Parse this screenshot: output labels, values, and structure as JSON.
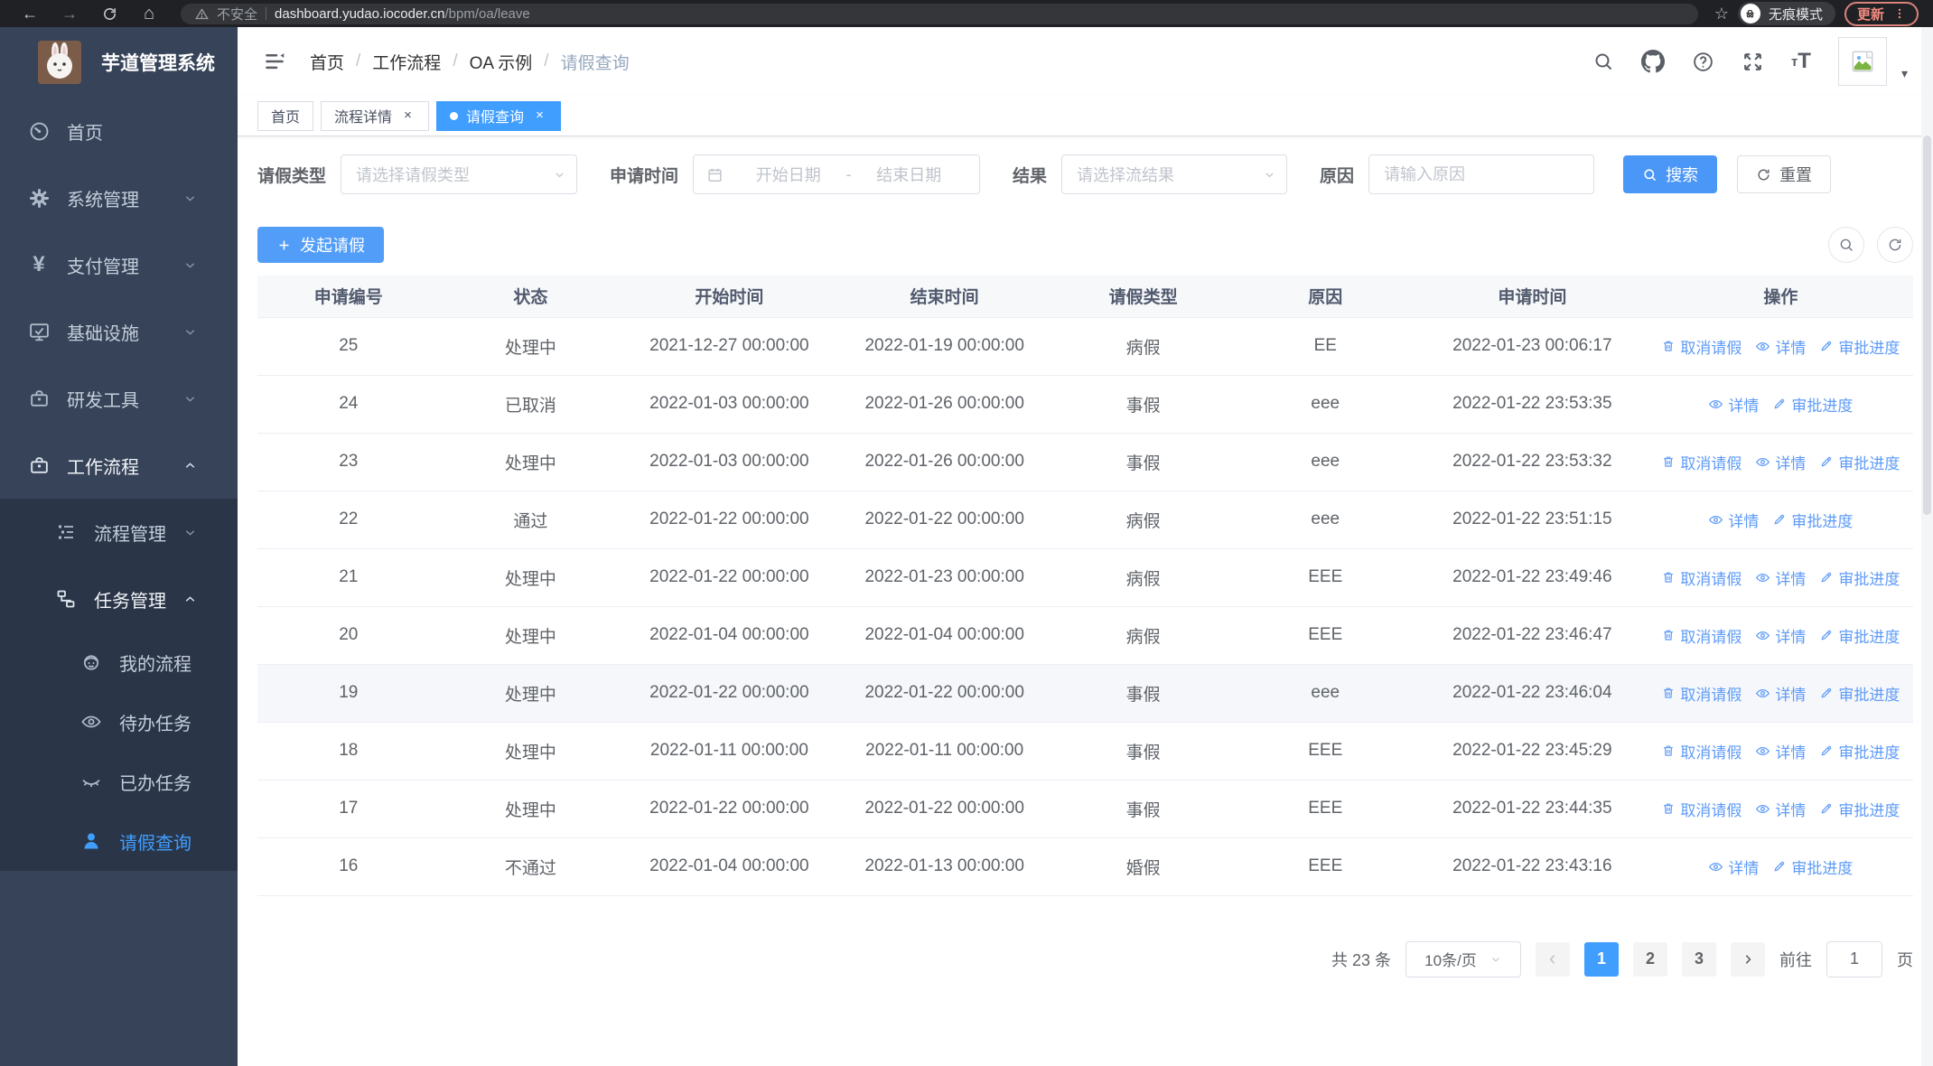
{
  "colors": {
    "primary": "#409eff",
    "sidebar_bg": "#364358",
    "submenu_bg": "#2a3547",
    "link_blue": "#5e9bf8",
    "update_accent": "#f28b82",
    "tab_active": "#409eff"
  },
  "icons": {
    "back": "←",
    "forward": "→",
    "home_glyph": "⌂",
    "star": "☆",
    "close": "×",
    "caret_down": "▾",
    "plus_note": "plus",
    "font_small": "т",
    "font_big": "T"
  },
  "browser": {
    "security_label": "不安全",
    "url_host": "dashboard.yudao.iocoder.cn",
    "url_path": "/bpm/oa/leave",
    "incognito_label": "无痕模式",
    "update_label": "更新"
  },
  "sidebar": {
    "title": "芋道管理系统",
    "items": [
      {
        "label": "首页"
      },
      {
        "label": "系统管理"
      },
      {
        "label": "支付管理"
      },
      {
        "label": "基础设施"
      },
      {
        "label": "研发工具"
      },
      {
        "label": "工作流程"
      },
      {
        "label": "流程管理"
      },
      {
        "label": "任务管理"
      },
      {
        "label": "我的流程"
      },
      {
        "label": "待办任务"
      },
      {
        "label": "已办任务"
      },
      {
        "label": "请假查询"
      }
    ]
  },
  "breadcrumb": {
    "items": [
      "首页",
      "工作流程",
      "OA 示例",
      "请假查询"
    ]
  },
  "tabs": [
    {
      "label": "首页",
      "closable": false,
      "active": false
    },
    {
      "label": "流程详情",
      "closable": true,
      "active": false
    },
    {
      "label": "请假查询",
      "closable": true,
      "active": true
    }
  ],
  "filters": {
    "leave_type_label": "请假类型",
    "leave_type_placeholder": "请选择请假类型",
    "apply_time_label": "申请时间",
    "start_date_placeholder": "开始日期",
    "range_separator": "-",
    "end_date_placeholder": "结束日期",
    "result_label": "结果",
    "result_placeholder": "请选择流结果",
    "reason_label": "原因",
    "reason_placeholder": "请输入原因",
    "search_label": "搜索",
    "reset_label": "重置"
  },
  "toolbar": {
    "create_label": "发起请假"
  },
  "table": {
    "headers": [
      "申请编号",
      "状态",
      "开始时间",
      "结束时间",
      "请假类型",
      "原因",
      "申请时间",
      "操作"
    ],
    "action_labels": {
      "cancel": "取消请假",
      "detail": "详情",
      "progress": "审批进度"
    },
    "rows": [
      {
        "id": "25",
        "status": "处理中",
        "start": "2021-12-27 00:00:00",
        "end": "2022-01-19 00:00:00",
        "type": "病假",
        "reason": "EE",
        "applied": "2022-01-23 00:06:17",
        "cancelable": true
      },
      {
        "id": "24",
        "status": "已取消",
        "start": "2022-01-03 00:00:00",
        "end": "2022-01-26 00:00:00",
        "type": "事假",
        "reason": "eee",
        "applied": "2022-01-22 23:53:35",
        "cancelable": false
      },
      {
        "id": "23",
        "status": "处理中",
        "start": "2022-01-03 00:00:00",
        "end": "2022-01-26 00:00:00",
        "type": "事假",
        "reason": "eee",
        "applied": "2022-01-22 23:53:32",
        "cancelable": true
      },
      {
        "id": "22",
        "status": "通过",
        "start": "2022-01-22 00:00:00",
        "end": "2022-01-22 00:00:00",
        "type": "病假",
        "reason": "eee",
        "applied": "2022-01-22 23:51:15",
        "cancelable": false
      },
      {
        "id": "21",
        "status": "处理中",
        "start": "2022-01-22 00:00:00",
        "end": "2022-01-23 00:00:00",
        "type": "病假",
        "reason": "EEE",
        "applied": "2022-01-22 23:49:46",
        "cancelable": true
      },
      {
        "id": "20",
        "status": "处理中",
        "start": "2022-01-04 00:00:00",
        "end": "2022-01-04 00:00:00",
        "type": "病假",
        "reason": "EEE",
        "applied": "2022-01-22 23:46:47",
        "cancelable": true
      },
      {
        "id": "19",
        "status": "处理中",
        "start": "2022-01-22 00:00:00",
        "end": "2022-01-22 00:00:00",
        "type": "事假",
        "reason": "eee",
        "applied": "2022-01-22 23:46:04",
        "cancelable": true
      },
      {
        "id": "18",
        "status": "处理中",
        "start": "2022-01-11 00:00:00",
        "end": "2022-01-11 00:00:00",
        "type": "事假",
        "reason": "EEE",
        "applied": "2022-01-22 23:45:29",
        "cancelable": true
      },
      {
        "id": "17",
        "status": "处理中",
        "start": "2022-01-22 00:00:00",
        "end": "2022-01-22 00:00:00",
        "type": "事假",
        "reason": "EEE",
        "applied": "2022-01-22 23:44:35",
        "cancelable": true
      },
      {
        "id": "16",
        "status": "不通过",
        "start": "2022-01-04 00:00:00",
        "end": "2022-01-13 00:00:00",
        "type": "婚假",
        "reason": "EEE",
        "applied": "2022-01-22 23:43:16",
        "cancelable": false
      }
    ]
  },
  "pagination": {
    "total_label": "共 23 条",
    "page_size": "10条/页",
    "pages": [
      "1",
      "2",
      "3"
    ],
    "active_page": "1",
    "goto_label": "前往",
    "goto_value": "1",
    "page_unit": "页"
  }
}
